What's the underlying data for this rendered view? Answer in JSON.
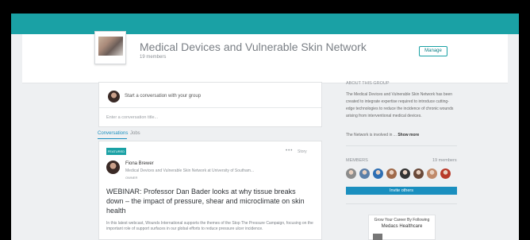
{
  "group": {
    "title": "Medical Devices and Vulnerable Skin Network",
    "members": "19 members",
    "manage_label": "Manage"
  },
  "composer": {
    "prompt": "Start a conversation with your group",
    "title_placeholder": "Enter a conversation title..."
  },
  "tabs": [
    {
      "label": "Conversations",
      "active": true
    },
    {
      "label": "Jobs",
      "active": false
    }
  ],
  "post": {
    "badge": "FEATURED",
    "more_icon": "•••",
    "more_label": "Story",
    "author": "Fiona Brewer",
    "author_subtitle": "Medical Devices and Vulnerable Skin Network at University of Southam...",
    "role": "OWNER",
    "title": "WEBINAR: Professor Dan Bader looks at why tissue breaks down – the impact of pressure, shear and microclimate on skin health",
    "excerpt": "In this latest webcast, Wounds International supports the themes of the Stop The Pressure Campaign, focusing on the important role of support surfaces in our global efforts to reduce pressure ulcer incidence."
  },
  "about": {
    "heading": "ABOUT THIS GROUP",
    "description": "The Medical Devices and Vulnerable Skin Network has been created to integrate expertise required to introduce cutting-edge technologies to reduce the incidence of chronic wounds arising from interventional medical devices.",
    "more_prefix": "The Network is involved in ...",
    "more_link": "Show more"
  },
  "members_section": {
    "heading": "MEMBERS",
    "count": "19 members",
    "invite_label": "Invite others",
    "avatar_colors": [
      "#8c8c8c",
      "#5b7fa8",
      "#2e6fb3",
      "#a06a4a",
      "#333333",
      "#6a4a3a",
      "#c08a6a",
      "#b83a2a"
    ]
  },
  "promo": {
    "line1": "Grow Your Career By Following",
    "line2": "Medacs Healthcare"
  },
  "colors": {
    "teal": "#1aa1a5",
    "link_blue": "#1a8fbf"
  }
}
